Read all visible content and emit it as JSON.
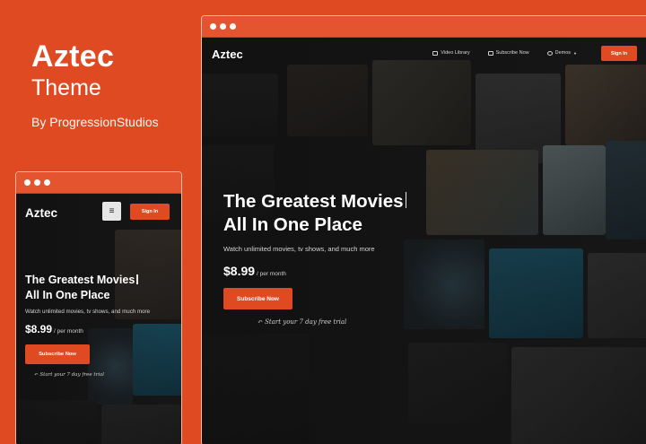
{
  "brand": {
    "title": "Aztec",
    "subtitle": "Theme",
    "byline": "By ProgressionStudios"
  },
  "desktop": {
    "logo": "Aztec",
    "nav": [
      "Video Library",
      "Subscribe Now",
      "Demos"
    ],
    "signin": "Sign In",
    "headline_1": "The Greatest Movies",
    "headline_2": "All In One Place",
    "subtext": "Watch unlimited movies, tv shows, and much more",
    "price": "$8.99",
    "price_unit": "/ per month",
    "cta": "Subscribe Now",
    "trial": "Start your 7 day free trial"
  },
  "mobile": {
    "logo": "Aztec",
    "menu_icon": "≡",
    "signin": "Sign In",
    "headline_1": "The Greatest Movies",
    "headline_2": "All In One Place",
    "subtext": "Watch unlimited movies, tv shows, and much more",
    "price": "$8.99",
    "price_unit": "/ per month",
    "cta": "Subscribe Now",
    "trial": "Start your 7 day free trial"
  },
  "colors": {
    "accent": "#e04a22",
    "window_border": "#f7b8a4",
    "dark_bg": "#1a1a1a"
  },
  "icons": {
    "video_library": "monitor-icon",
    "subscribe_now": "card-icon",
    "demos": "globe-icon",
    "menu": "hamburger-icon"
  }
}
